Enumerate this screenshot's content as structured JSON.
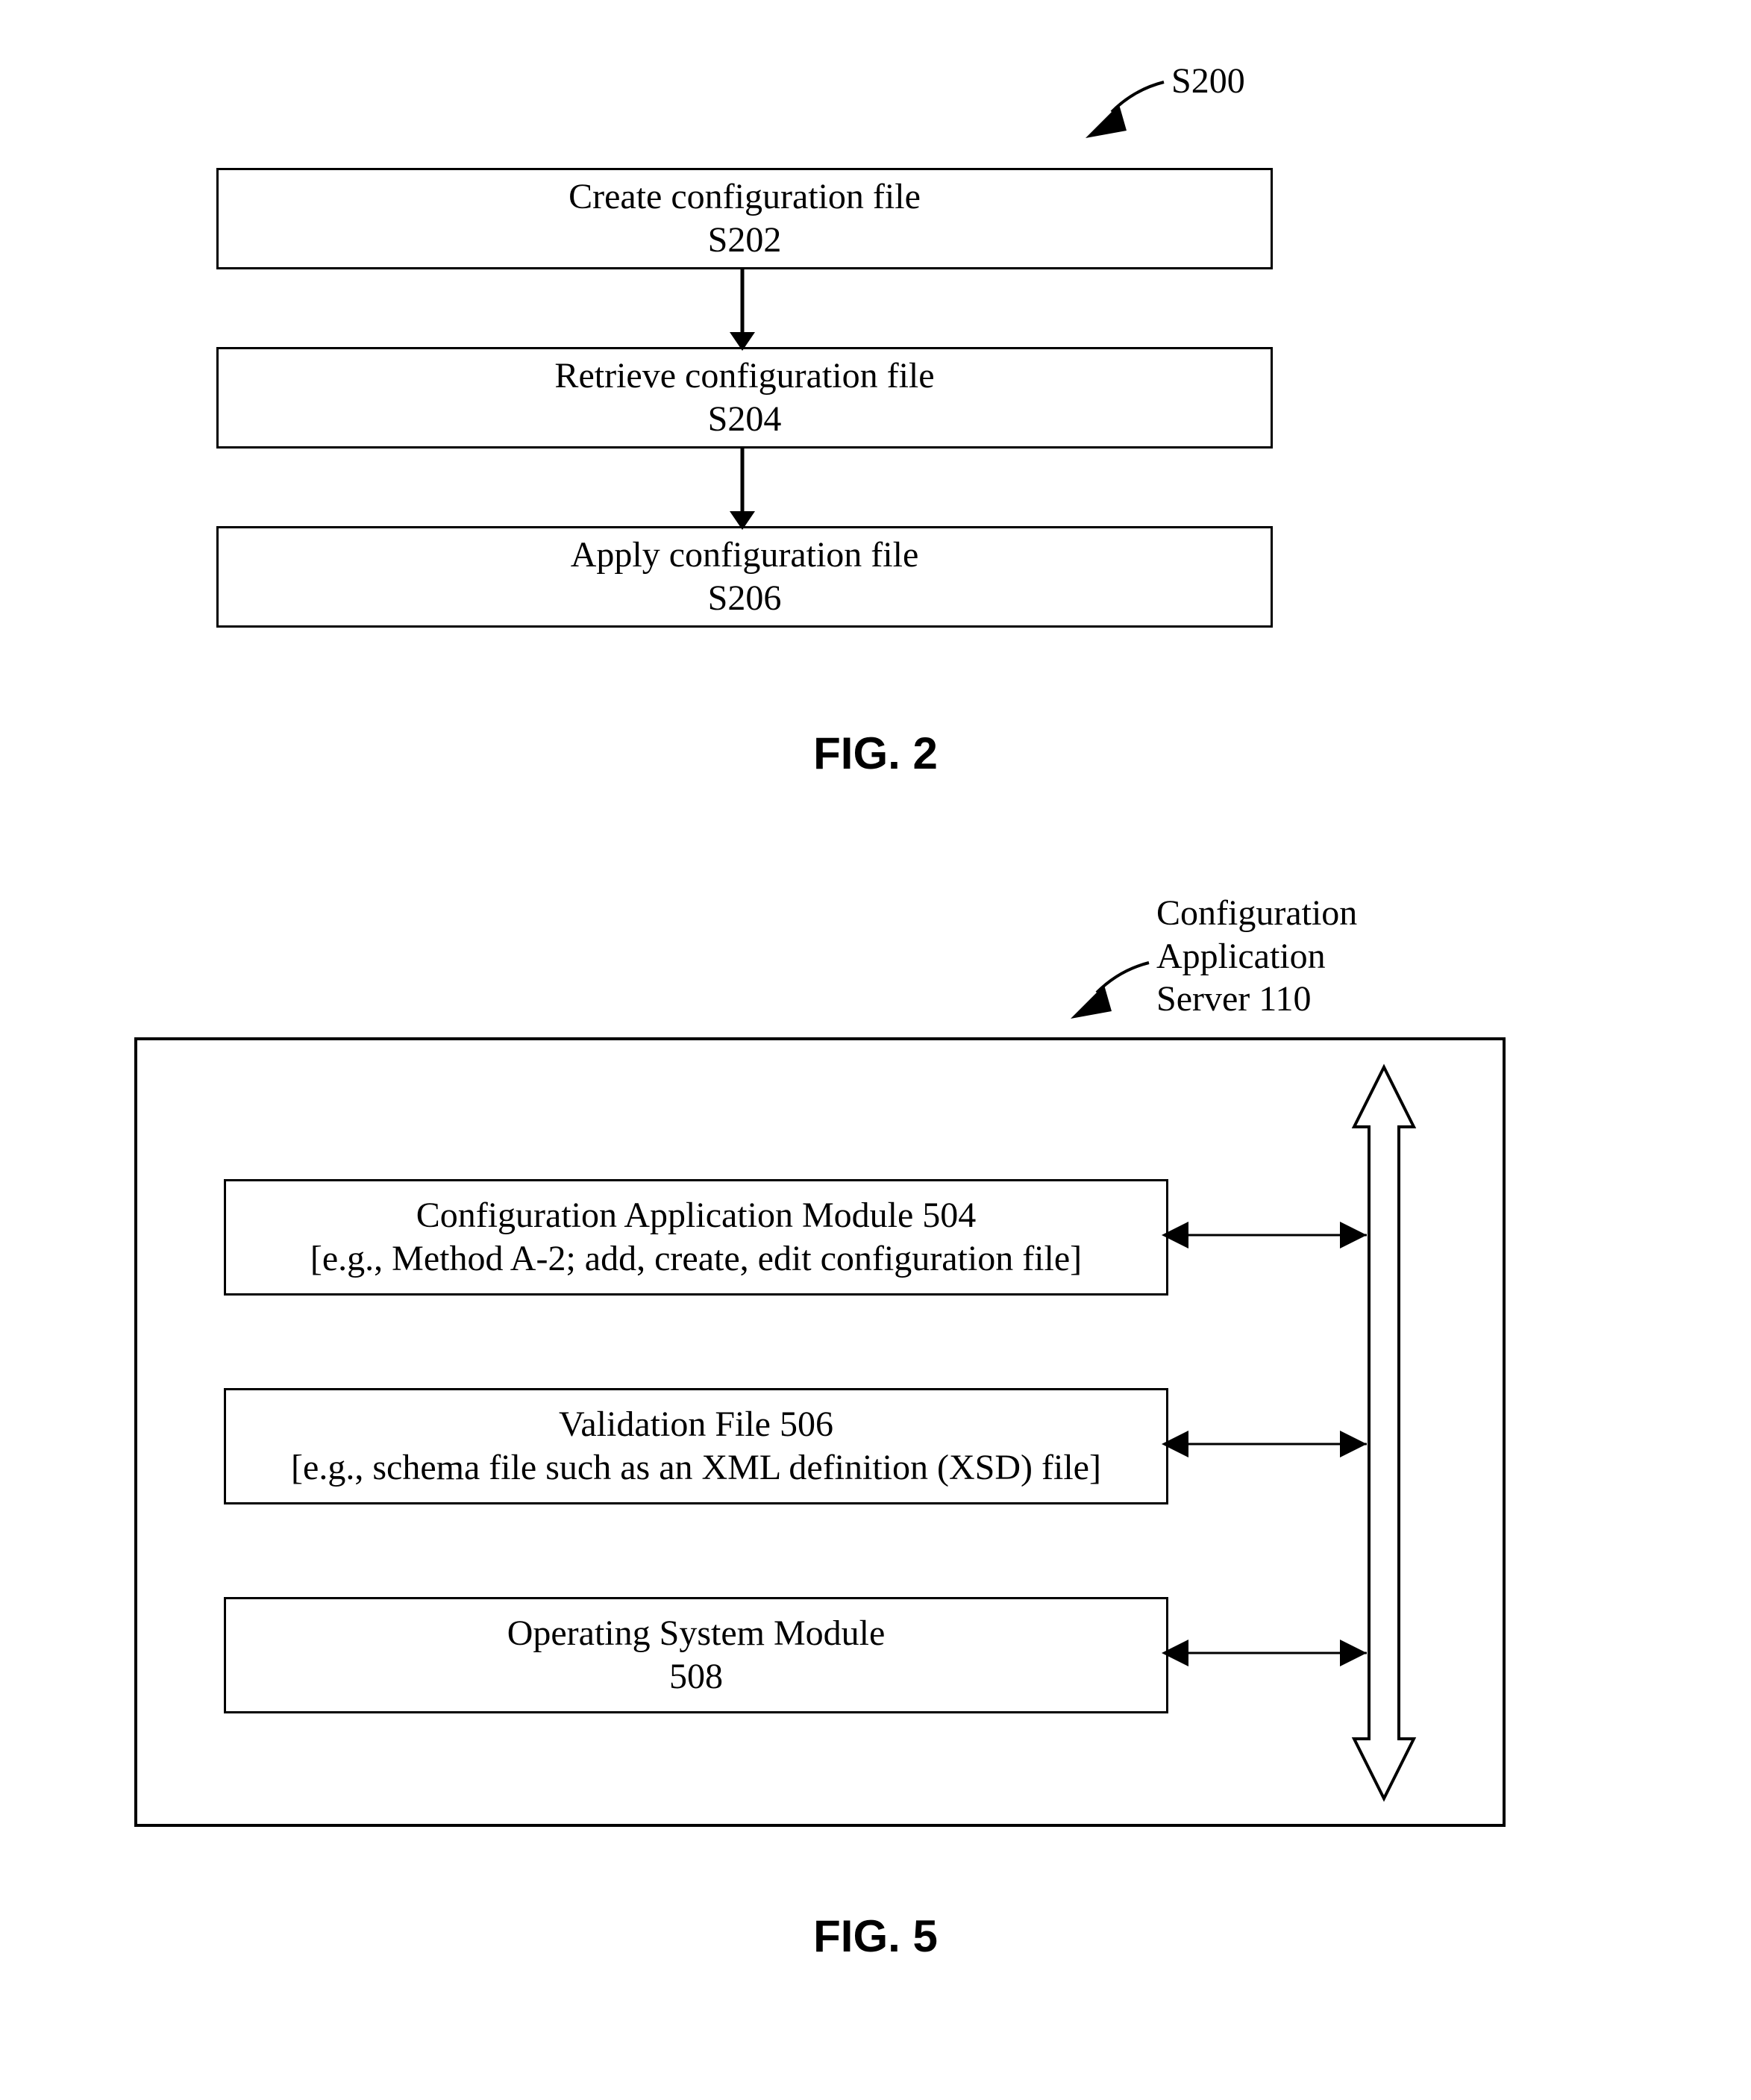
{
  "fig2": {
    "label": "S200",
    "steps": [
      {
        "title": "Create configuration file",
        "ref": "S202"
      },
      {
        "title": "Retrieve configuration file",
        "ref": "S204"
      },
      {
        "title": "Apply configuration file",
        "ref": "S206"
      }
    ],
    "caption": "FIG. 2"
  },
  "fig5": {
    "label_line1": "Configuration",
    "label_line2": "Application",
    "label_line3": "Server 110",
    "modules": [
      {
        "title": "Configuration Application Module 504",
        "sub": "[e.g., Method A-2; add, create, edit configuration file]"
      },
      {
        "title": "Validation File 506",
        "sub": "[e.g., schema file such as an XML definition (XSD) file]"
      },
      {
        "title": "Operating System Module",
        "sub": "508"
      }
    ],
    "caption": "FIG. 5"
  }
}
